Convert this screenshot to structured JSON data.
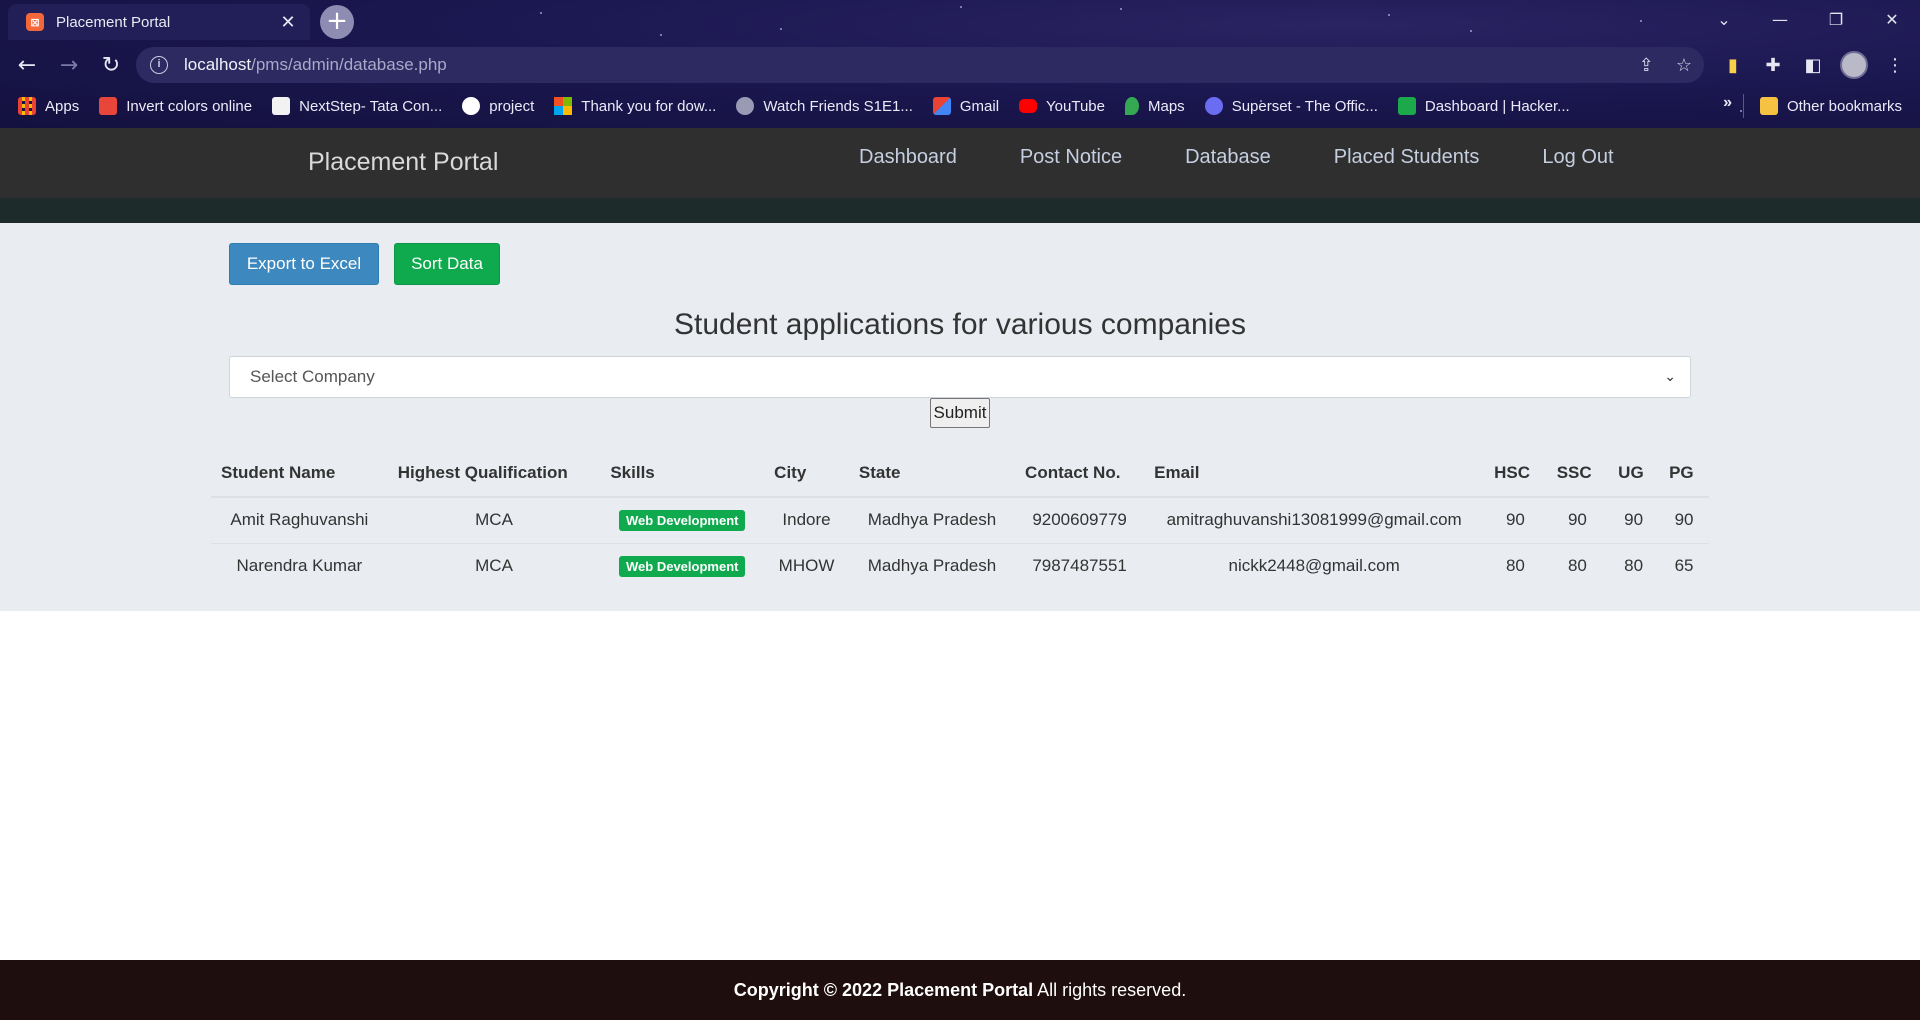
{
  "browser": {
    "tab_title": "Placement Portal",
    "tab_favicon": "xampp-icon",
    "url_host": "localhost",
    "url_path": "/pms/admin/database.php",
    "window_controls": [
      "chevron-down-icon",
      "minimize-icon",
      "restore-icon",
      "close-icon"
    ]
  },
  "bookmarks": {
    "items": [
      {
        "label": "Apps",
        "icon": "apps-grid-icon",
        "color": "#ea4335"
      },
      {
        "label": "Invert colors online",
        "icon": "tree-icon",
        "color": "#e8463a"
      },
      {
        "label": "NextStep- Tata Con...",
        "icon": "tcs-icon",
        "color": "#f2f2f2"
      },
      {
        "label": "project",
        "icon": "github-icon",
        "color": "#ffffff"
      },
      {
        "label": "Thank you for dow...",
        "icon": "microsoft-icon",
        "color": "#00a4ef"
      },
      {
        "label": "Watch Friends S1E1...",
        "icon": "globe-icon",
        "color": "#9a9ab5"
      },
      {
        "label": "Gmail",
        "icon": "gmail-icon",
        "color": "#ea4335"
      },
      {
        "label": "YouTube",
        "icon": "youtube-icon",
        "color": "#ff0000"
      },
      {
        "label": "Maps",
        "icon": "maps-icon",
        "color": "#34a853"
      },
      {
        "label": "Superset - The Offic...",
        "icon": "superset-icon",
        "color": "#6a6cf2"
      },
      {
        "label": "Dashboard | Hacker...",
        "icon": "hackerrank-icon",
        "color": "#1ba94c"
      }
    ],
    "more": "»",
    "other": "Other bookmarks"
  },
  "site": {
    "brand": "Placement Portal",
    "menu": [
      "Dashboard",
      "Post Notice",
      "Database",
      "Placed Students",
      "Log Out"
    ],
    "export_label": "Export to Excel",
    "sort_label": "Sort Data",
    "heading": "Student applications for various companies",
    "select_value": "Select Company",
    "submit_label": "Submit"
  },
  "table": {
    "headers": [
      "Student Name",
      "Highest Qualification",
      "Skills",
      "City",
      "State",
      "Contact No.",
      "Email",
      "HSC",
      "SSC",
      "UG",
      "PG"
    ],
    "rows": [
      {
        "name": "Amit Raghuvanshi",
        "qualification": "MCA",
        "skill": "Web Development",
        "city": "Indore",
        "state": "Madhya Pradesh",
        "contact": "9200609779",
        "email": "amitraghuvanshi13081999@gmail.com",
        "hsc": "90",
        "ssc": "90",
        "ug": "90",
        "pg": "90"
      },
      {
        "name": "Narendra Kumar",
        "qualification": "MCA",
        "skill": "Web Development",
        "city": "MHOW",
        "state": "Madhya Pradesh",
        "contact": "7987487551",
        "email": "nickk2448@gmail.com",
        "hsc": "80",
        "ssc": "80",
        "ug": "80",
        "pg": "65"
      }
    ]
  },
  "footer": {
    "prefix": "Copyright © 2022 Placement Portal",
    "suffix": " All rights reserved."
  },
  "colors": {
    "nav_bg": "#2f2f2f",
    "export_button": "#3c88bf",
    "sort_button": "#0fa94e",
    "badge": "#0fa94e",
    "footer_bg": "#1f0e0e"
  }
}
